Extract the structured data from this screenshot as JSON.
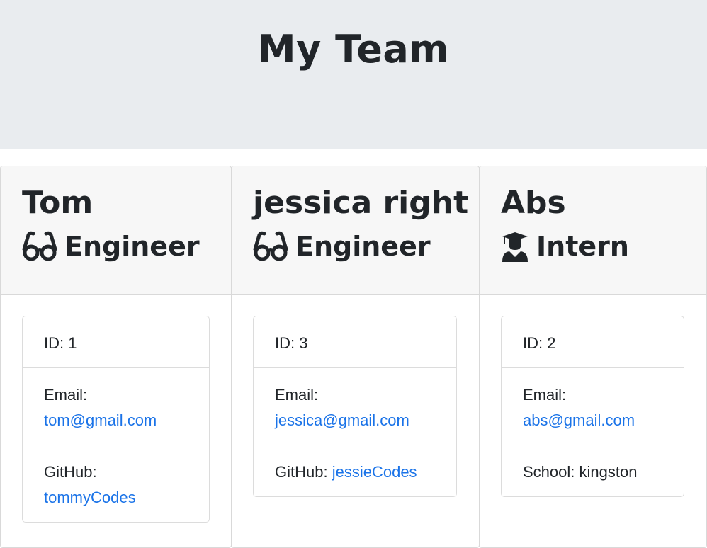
{
  "header": {
    "title": "My Team"
  },
  "cards": [
    {
      "name": "Tom",
      "role": "Engineer",
      "icon": "glasses-icon",
      "id_text": "ID: 1",
      "email_label": "Email:",
      "email": "tom@gmail.com",
      "extra_label": "GitHub:",
      "extra_value": "tommyCodes"
    },
    {
      "name": "jessica right",
      "role": "Engineer",
      "icon": "glasses-icon",
      "id_text": "ID: 3",
      "email_label": "Email:",
      "email": "jessica@gmail.com",
      "extra_label": "GitHub:",
      "extra_value": "jessieCodes"
    },
    {
      "name": "Abs",
      "role": "Intern",
      "icon": "graduate-icon",
      "id_text": "ID: 2",
      "email_label": "Email:",
      "email": "abs@gmail.com",
      "extra_label": "School:",
      "extra_value": "kingston"
    }
  ],
  "colors": {
    "jumbotron": "#e9ecef",
    "link": "#1a73e8",
    "card_header": "#f7f7f7"
  }
}
